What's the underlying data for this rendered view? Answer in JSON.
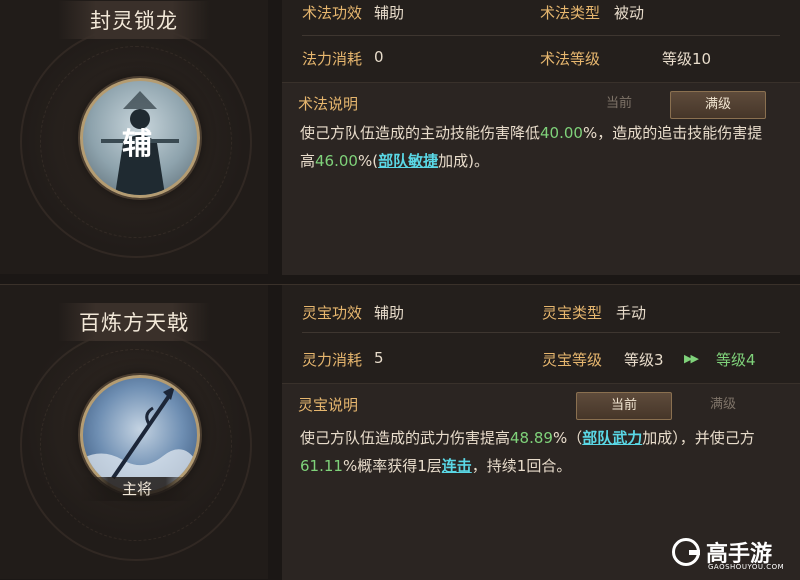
{
  "skill": {
    "name": "封灵锁龙",
    "portrait_glyph": "辅",
    "effect_label": "术法功效",
    "effect_value": "辅助",
    "type_label": "术法类型",
    "type_value": "被动",
    "cost_label": "法力消耗",
    "cost_value": "0",
    "level_label": "术法等级",
    "level_value": "等级10",
    "desc_title": "术法说明",
    "tab_current": "当前",
    "tab_max": "满级",
    "desc_1": "使己方队伍造成的主动技能伤害降低",
    "desc_val1": "40.00",
    "desc_2": "%，造成的追击技能伤害提",
    "desc_3": "高",
    "desc_val2": "46.00",
    "desc_4": "%(",
    "desc_link": "部队敏捷",
    "desc_5": "加成)。"
  },
  "treasure": {
    "name": "百炼方天戟",
    "role": "主将",
    "effect_label": "灵宝功效",
    "effect_value": "辅助",
    "type_label": "灵宝类型",
    "type_value": "手动",
    "cost_label": "灵力消耗",
    "cost_value": "5",
    "level_label": "灵宝等级",
    "level_from": "等级3",
    "level_to": "等级4",
    "desc_title": "灵宝说明",
    "tab_current": "当前",
    "tab_max": "满级",
    "desc_1": "使己方队伍造成的武力伤害提高",
    "desc_val1": "48.89",
    "desc_2": "%（",
    "desc_link1": "部队武力",
    "desc_3": "加成），并使己方",
    "desc_val2": "61.11",
    "desc_4": "%概率获得1层",
    "desc_link2": "连击",
    "desc_5": "，持续1回合。"
  },
  "watermark": {
    "brand": "高手游",
    "url": "GAOSHOUYOU.COM"
  },
  "colors": {
    "label_gold": "#e6b66e",
    "value_green": "#7fd27a",
    "link_cyan": "#5ad8e6"
  },
  "icons": [
    "double-chevron-right-icon",
    "staff-figure-icon",
    "halberd-icon"
  ]
}
